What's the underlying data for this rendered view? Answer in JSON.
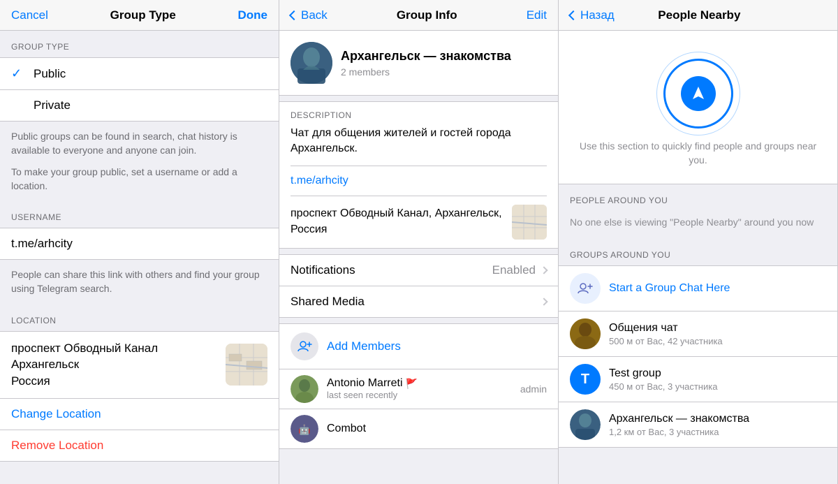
{
  "panel1": {
    "nav": {
      "cancel": "Cancel",
      "title": "Group Type",
      "done": "Done"
    },
    "sectionGroupType": "GROUP TYPE",
    "options": [
      {
        "label": "Public",
        "selected": true
      },
      {
        "label": "Private",
        "selected": false
      }
    ],
    "infoText1": "Public groups can be found in search, chat history is available to everyone and anyone can join.",
    "infoText2": "To make your group public, set a username or add a location.",
    "sectionUsername": "USERNAME",
    "username": "t.me/arhcity",
    "usernameInfo": "People can share this link with others and find your group using Telegram search.",
    "sectionLocation": "LOCATION",
    "locationLine1": "проспект Обводный Канал",
    "locationLine2": "Архангельск",
    "locationLine3": "Россия",
    "changeLocation": "Change Location",
    "removeLocation": "Remove Location"
  },
  "panel2": {
    "nav": {
      "back": "Back",
      "title": "Group Info",
      "edit": "Edit"
    },
    "group": {
      "name": "Архангельск — знакомства",
      "members": "2 members"
    },
    "sectionDescription": "DESCRIPTION",
    "description": "Чат для общения жителей и гостей города Архангельск.",
    "usernameLink": "t.me/arhcity",
    "location": "проспект Обводный Канал, Архангельск, Россия",
    "notifications": "Notifications",
    "notificationsValue": "Enabled",
    "sharedMedia": "Shared Media",
    "addMembers": "Add Members",
    "members": [
      {
        "name": "Antonio Marreti",
        "status": "last seen recently",
        "role": "admin",
        "hasFlag": true
      },
      {
        "name": "Combot",
        "status": "",
        "role": "",
        "hasFlag": false
      }
    ]
  },
  "panel3": {
    "nav": {
      "back": "Назад",
      "title": "People Nearby"
    },
    "illustrationText": "Use this section to quickly find people and groups near you.",
    "sectionPeopleAround": "PEOPLE AROUND YOU",
    "noOneText": "No one else is viewing \"People Nearby\" around you now",
    "sectionGroupsAround": "GROUPS AROUND YOU",
    "groups": [
      {
        "name": "Start a Group Chat Here",
        "distance": "",
        "isAction": true,
        "color": "#e8eaf6",
        "iconColor": "#5c6bc0"
      },
      {
        "name": "Общения чат",
        "distance": "500 м от Вас, 42 участника",
        "isAction": false,
        "color": "#8B6914",
        "initial": ""
      },
      {
        "name": "Test group",
        "distance": "450 м от Вас, 3 участника",
        "isAction": false,
        "color": "#007aff",
        "initial": "T"
      },
      {
        "name": "Архангельск — знакомства",
        "distance": "1,2 км от Вас, 3 участника",
        "isAction": false,
        "color": "#5a7a9a",
        "initial": ""
      }
    ]
  }
}
